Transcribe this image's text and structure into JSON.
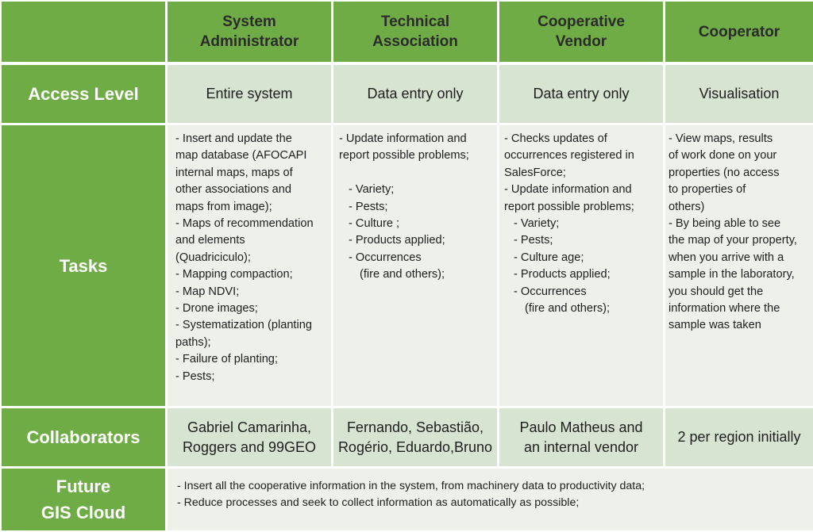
{
  "header": {
    "corner": "",
    "columns": [
      {
        "line1": "System",
        "line2": "Administrator"
      },
      {
        "line1": "Technical",
        "line2": "Association"
      },
      {
        "line1": "Cooperative",
        "line2": "Vendor"
      },
      {
        "line1": "Cooperator",
        "line2": ""
      }
    ]
  },
  "access_level": {
    "label": "Access  Level",
    "values": [
      "Entire system",
      "Data entry only",
      "Data entry only",
      "Visualisation"
    ]
  },
  "tasks": {
    "label": "Tasks",
    "system_administrator": [
      "- Insert and update the",
      "map database (AFOCAPI",
      "internal maps, maps of",
      "other associations and",
      "maps from image);",
      "- Maps of recommendation",
      "and elements",
      "(Quadriciculo);",
      "- Mapping compaction;",
      "- Map NDVI;",
      "- Drone images;",
      "- Systematization (planting",
      "paths);",
      "- Failure of planting;",
      "- Pests;"
    ],
    "technical_association": {
      "intro": [
        "- Update information and",
        "report possible problems;"
      ],
      "items": [
        "- Variety;",
        "- Pests;",
        "- Culture ;",
        "- Products applied;",
        "- Occurrences"
      ],
      "continuation": "(fire and others);"
    },
    "cooperative_vendor": {
      "intro": [
        "- Checks updates of",
        "occurrences registered in",
        "SalesForce;",
        "- Update information and",
        "report possible problems;"
      ],
      "items": [
        "- Variety;",
        "- Pests;",
        "- Culture age;",
        "- Products applied;",
        "- Occurrences"
      ],
      "continuation": "(fire and others);"
    },
    "cooperator": [
      "- View maps, results",
      "of work done on your",
      "properties (no access",
      "to properties of",
      "others)",
      "- By being able to see",
      "the map of your property,",
      "when you arrive with a",
      "sample in the laboratory,",
      "you should get the",
      "information where the",
      "sample was taken"
    ]
  },
  "collaborators": {
    "label": "Collaborators",
    "values": [
      {
        "line1": "Gabriel Camarinha,",
        "line2": "Roggers and 99GEO"
      },
      {
        "line1": "Fernando, Sebastião,",
        "line2": "Rogério, Eduardo,Bruno"
      },
      {
        "line1": "Paulo Matheus and",
        "line2": "an internal vendor"
      },
      {
        "line1": "2 per region initially",
        "line2": ""
      }
    ]
  },
  "future": {
    "label_line1": "Future",
    "label_line2": "GIS Cloud",
    "items": [
      "- Insert all the cooperative  information in the system, from machinery data  to productivity data;",
      "- Reduce processes and seek to collect information as automatically as possible;"
    ]
  },
  "colors": {
    "green": "#6fac46",
    "light_green": "#d8e4d2",
    "pale": "#eef0ea",
    "header_text": "#2b2b2b",
    "label_text": "#ffffff"
  }
}
